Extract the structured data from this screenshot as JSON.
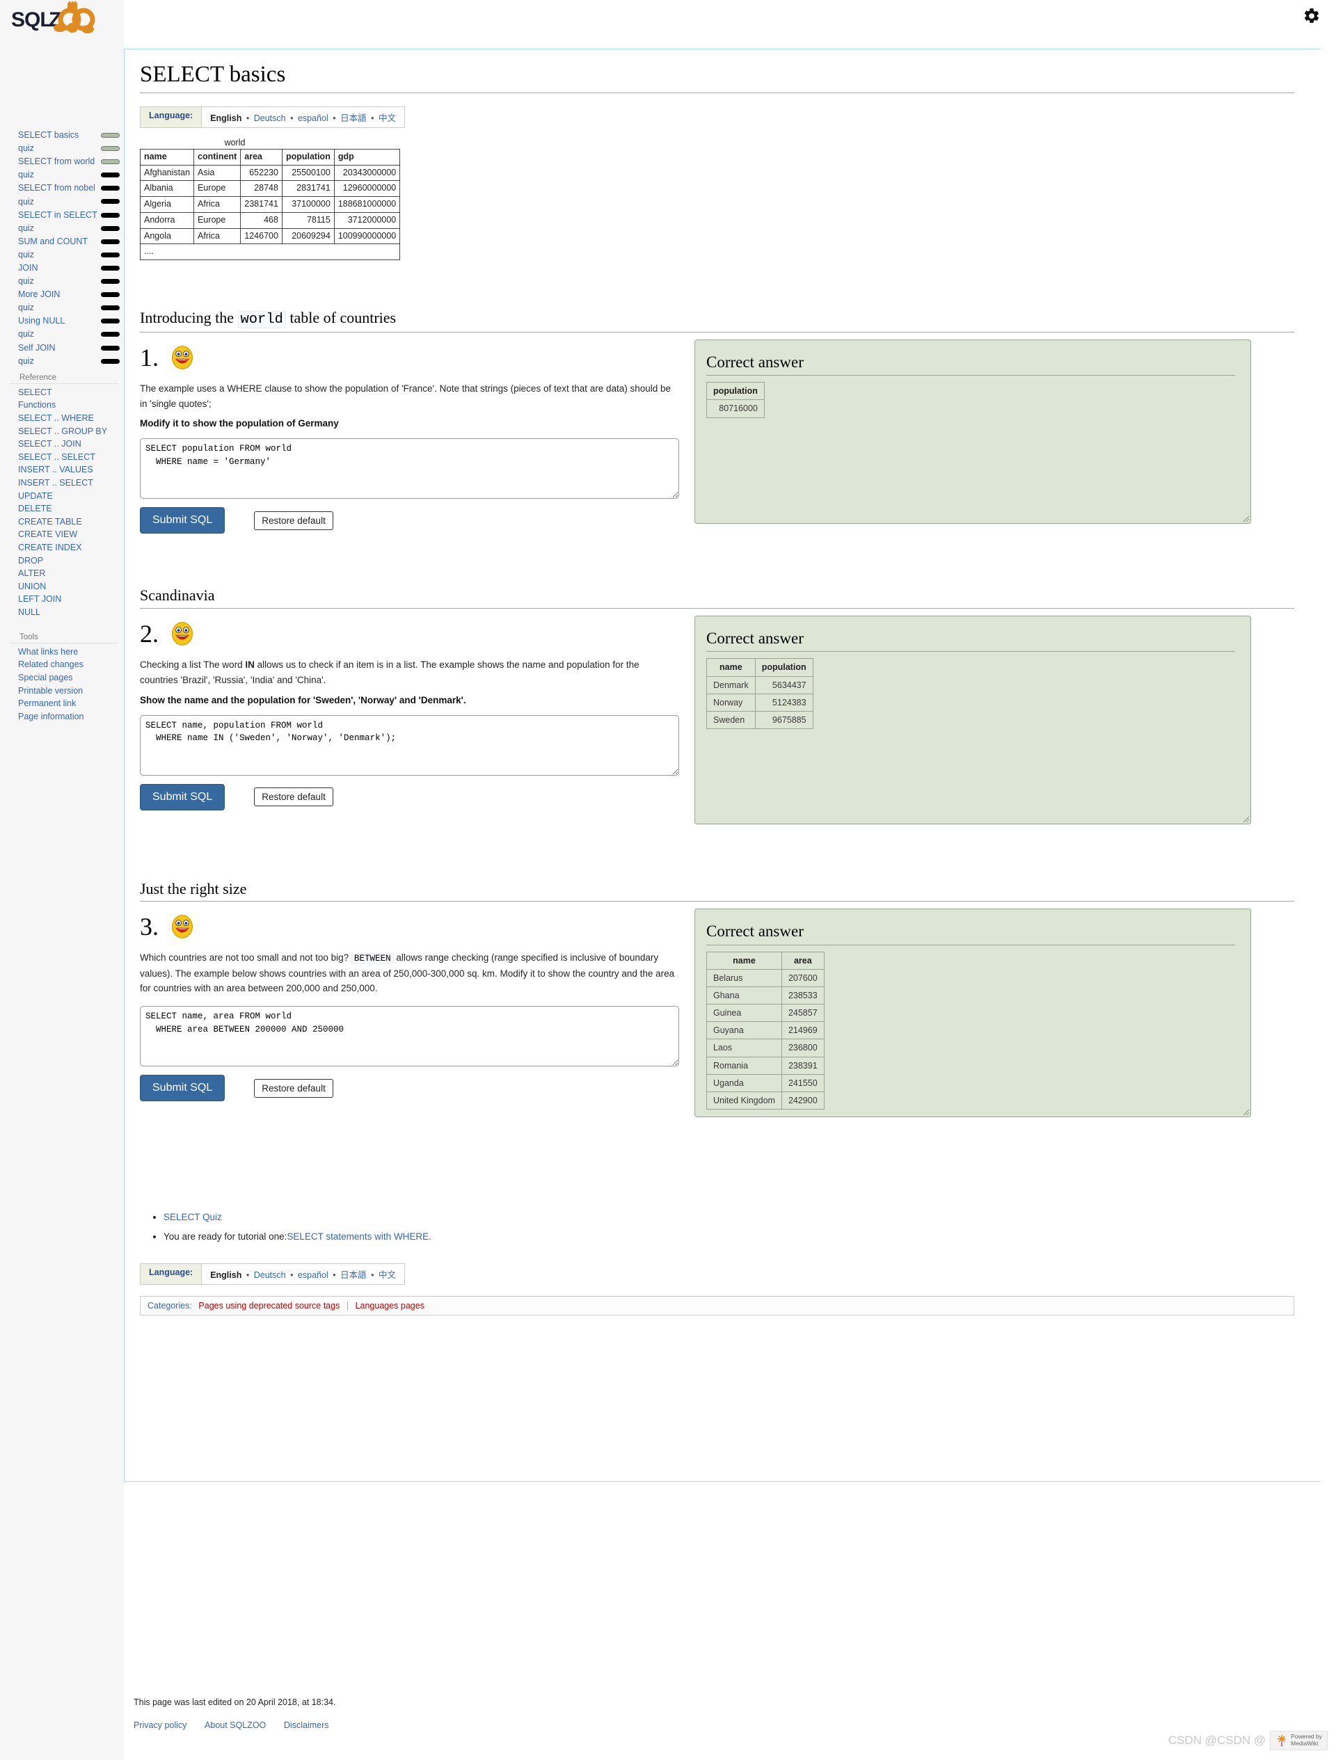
{
  "header": {
    "gear_icon": "gear-icon",
    "logo_alt": "SQLZOO"
  },
  "sidebar": {
    "tutorials": [
      {
        "label": "SELECT basics",
        "status": "open"
      },
      {
        "label": "quiz",
        "status": "open"
      },
      {
        "label": "SELECT from world",
        "status": "open"
      },
      {
        "label": "quiz",
        "status": "done"
      },
      {
        "label": "SELECT from nobel",
        "status": "done"
      },
      {
        "label": "quiz",
        "status": "done"
      },
      {
        "label": "SELECT in SELECT",
        "status": "done"
      },
      {
        "label": "quiz",
        "status": "done"
      },
      {
        "label": "SUM and COUNT",
        "status": "done"
      },
      {
        "label": "quiz",
        "status": "done"
      },
      {
        "label": "JOIN",
        "status": "done"
      },
      {
        "label": "quiz",
        "status": "done"
      },
      {
        "label": "More JOIN",
        "status": "done"
      },
      {
        "label": "quiz",
        "status": "done"
      },
      {
        "label": "Using NULL",
        "status": "done"
      },
      {
        "label": "quiz",
        "status": "done"
      },
      {
        "label": "Self JOIN",
        "status": "done"
      },
      {
        "label": "quiz",
        "status": "done"
      }
    ],
    "reference_heading": "Reference",
    "reference": [
      "SELECT",
      "Functions",
      "SELECT .. WHERE",
      "SELECT .. GROUP BY",
      "SELECT .. JOIN",
      "SELECT .. SELECT",
      "INSERT .. VALUES",
      "INSERT .. SELECT",
      "UPDATE",
      "DELETE",
      "CREATE TABLE",
      "CREATE VIEW",
      "CREATE INDEX",
      "DROP",
      "ALTER",
      "UNION",
      "LEFT JOIN",
      "NULL"
    ],
    "tools_heading": "Tools",
    "tools": [
      "What links here",
      "Related changes",
      "Special pages",
      "Printable version",
      "Permanent link",
      "Page information"
    ]
  },
  "page": {
    "title": "SELECT basics",
    "language_bar": {
      "label": "Language:",
      "current": "English",
      "others": [
        "Deutsch",
        "español",
        "日本語",
        "中文"
      ],
      "separator": "•"
    },
    "world_table": {
      "caption": "world",
      "columns": [
        "name",
        "continent",
        "area",
        "population",
        "gdp"
      ],
      "rows": [
        [
          "Afghanistan",
          "Asia",
          "652230",
          "25500100",
          "20343000000"
        ],
        [
          "Albania",
          "Europe",
          "28748",
          "2831741",
          "12960000000"
        ],
        [
          "Algeria",
          "Africa",
          "2381741",
          "37100000",
          "188681000000"
        ],
        [
          "Andorra",
          "Europe",
          "468",
          "78115",
          "3712000000"
        ],
        [
          "Angola",
          "Africa",
          "1246700",
          "20609294",
          "100990000000"
        ]
      ],
      "ellipsis": "...."
    },
    "questions": [
      {
        "section_heading_pre": "Introducing the ",
        "section_heading_code": "world",
        "section_heading_post": " table of countries",
        "number": "1.",
        "smiley": "smiley-icon",
        "body": "The example uses a WHERE clause to show the population of 'France'. Note that strings (pieces of text that are data) should be in 'single quotes';",
        "task": "Modify it to show the population of Germany",
        "sql": "SELECT population FROM world\n  WHERE name = 'Germany'",
        "submit_label": "Submit SQL",
        "restore_label": "Restore default",
        "answer": {
          "title": "Correct answer",
          "columns": [
            "population"
          ],
          "rows": [
            [
              "80716000"
            ]
          ],
          "numeric_cols": [
            0
          ]
        }
      },
      {
        "section_heading_pre": "Scandinavia",
        "section_heading_code": "",
        "section_heading_post": "",
        "number": "2.",
        "smiley": "smiley-icon",
        "body_pre": "Checking a list The word ",
        "body_bold": "IN",
        "body_post": " allows us to check if an item is in a list. The example shows the name and population for the countries 'Brazil', 'Russia', 'India' and 'China'.",
        "task": "Show the name and the population for 'Sweden', 'Norway' and 'Denmark'.",
        "sql": "SELECT name, population FROM world\n  WHERE name IN ('Sweden', 'Norway', 'Denmark');",
        "submit_label": "Submit SQL",
        "restore_label": "Restore default",
        "answer": {
          "title": "Correct answer",
          "columns": [
            "name",
            "population"
          ],
          "rows": [
            [
              "Denmark",
              "5634437"
            ],
            [
              "Norway",
              "5124383"
            ],
            [
              "Sweden",
              "9675885"
            ]
          ],
          "numeric_cols": [
            1
          ]
        }
      },
      {
        "section_heading_pre": "Just the right size",
        "section_heading_code": "",
        "section_heading_post": "",
        "number": "3.",
        "smiley": "smiley-icon",
        "body_pre": "Which countries are not too small and not too big? ",
        "body_code": "BETWEEN",
        "body_post": " allows range checking (range specified is inclusive of boundary values). The example below shows countries with an area of 250,000-300,000 sq. km. Modify it to show the country and the area for countries with an area between 200,000 and 250,000.",
        "sql": "SELECT name, area FROM world\n  WHERE area BETWEEN 200000 AND 250000",
        "submit_label": "Submit SQL",
        "restore_label": "Restore default",
        "answer": {
          "title": "Correct answer",
          "columns": [
            "name",
            "area"
          ],
          "rows": [
            [
              "Belarus",
              "207600"
            ],
            [
              "Ghana",
              "238533"
            ],
            [
              "Guinea",
              "245857"
            ],
            [
              "Guyana",
              "214969"
            ],
            [
              "Laos",
              "236800"
            ],
            [
              "Romania",
              "238391"
            ],
            [
              "Uganda",
              "241550"
            ],
            [
              "United Kingdom",
              "242900"
            ]
          ],
          "numeric_cols": [
            1
          ]
        }
      }
    ],
    "end_links": [
      {
        "text": "SELECT Quiz",
        "link": true
      },
      {
        "prefix": "You are ready for tutorial one:",
        "text": "SELECT statements with WHERE.",
        "link": true
      }
    ],
    "categories": {
      "label": "Categories:",
      "items": [
        "Pages using deprecated source tags",
        "Languages pages"
      ],
      "separator": "|"
    }
  },
  "footer": {
    "last_edited": "This page was last edited on 20 April 2018, at 18:34.",
    "links": [
      "Privacy policy",
      "About SQLZOO",
      "Disclaimers"
    ]
  },
  "watermark": {
    "text": "CSDN @CSDN @",
    "badge_line1": "Powered by",
    "badge_line2": "MediaWiki"
  }
}
